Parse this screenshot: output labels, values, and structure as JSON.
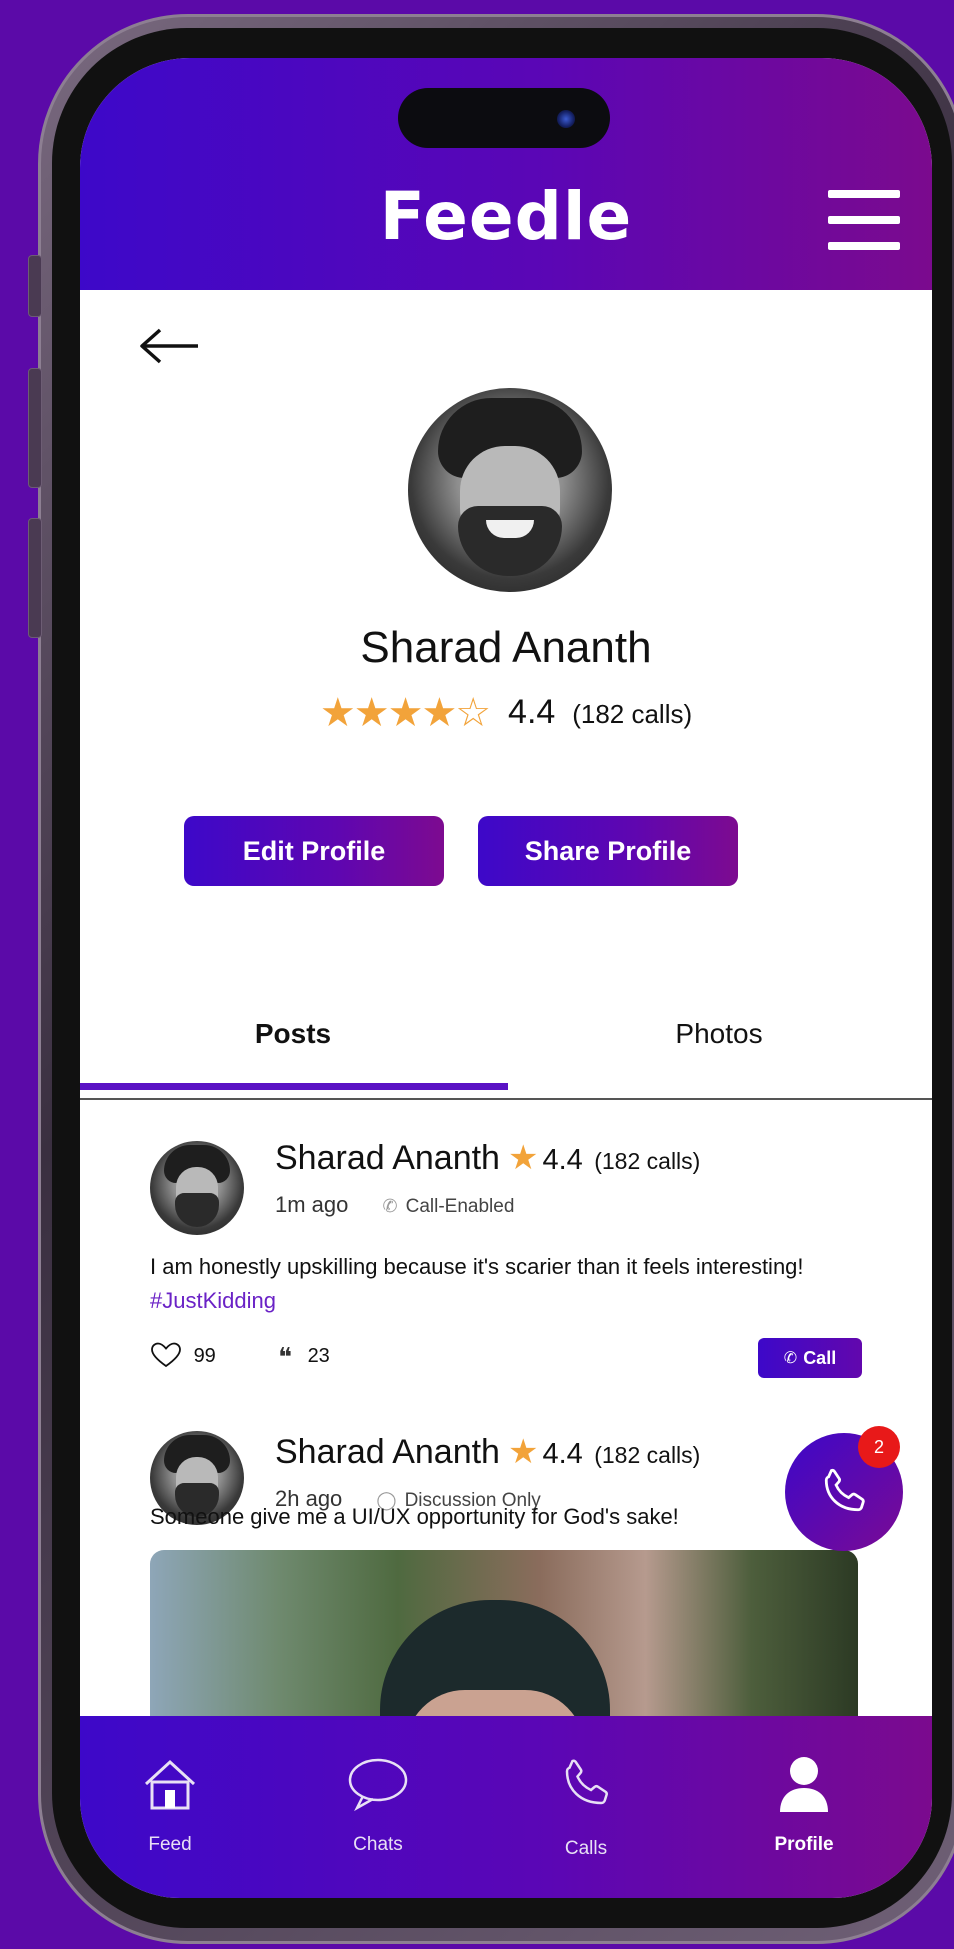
{
  "app": {
    "title": "Feedle"
  },
  "profile": {
    "name": "Sharad Ananth",
    "stars": "★★★★☆",
    "rating": "4.4",
    "calls": "(182 calls)"
  },
  "buttons": {
    "edit": "Edit Profile",
    "share": "Share Profile"
  },
  "tabs": [
    {
      "label": "Posts",
      "active": true
    },
    {
      "label": "Photos",
      "active": false
    }
  ],
  "posts": [
    {
      "author": "Sharad Ananth",
      "rating": "4.4",
      "calls": "(182 calls)",
      "time": "1m ago",
      "mode": "Call-Enabled",
      "text": "I am honestly upskilling because it's scarier than it feels interesting!",
      "hashtag": "#JustKidding",
      "likes": "99",
      "quotes": "23",
      "call_label": "Call"
    },
    {
      "author": "Sharad Ananth",
      "rating": "4.4",
      "calls": "(182 calls)",
      "time": "2h ago",
      "mode": "Discussion Only",
      "text": "Someone give me a UI/UX opportunity for God's sake!"
    }
  ],
  "fab": {
    "badge": "2"
  },
  "nav": [
    {
      "label": "Feed",
      "icon": "home-icon"
    },
    {
      "label": "Chats",
      "icon": "chat-bubble-icon"
    },
    {
      "label": "Calls",
      "icon": "phone-icon"
    },
    {
      "label": "Profile",
      "icon": "user-icon",
      "active": true
    }
  ],
  "colors": {
    "brand_start": "#3d08c9",
    "brand_end": "#7b0a8e",
    "star": "#f2a33a",
    "badge": "#e81919",
    "hashtag": "#6a22c6"
  }
}
